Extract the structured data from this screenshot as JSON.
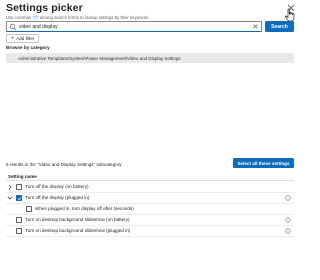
{
  "header": {
    "title": "Settings picker",
    "subtitle_before": "Use commas",
    "subtitle_highlight": "\",\"",
    "subtitle_after": "among search terms to lookup settings by their keywords"
  },
  "search": {
    "value": "video and display",
    "button_label": "Search"
  },
  "filters": {
    "add_filter_label": "Add filter"
  },
  "browse": {
    "label": "Browse by category",
    "category_path": "Administrative Templates\\System\\Power Management\\Video and Display Settings"
  },
  "results": {
    "count_text": "6 results in the \"Video and Display Settings\" subcategory",
    "select_all_label": "Select all these settings",
    "column_header": "Setting name",
    "rows": [
      {
        "label": "Turn off the display (on battery)",
        "checked": false,
        "expanded": false
      },
      {
        "label": "Turn off the display (plugged in)",
        "checked": true,
        "expanded": true
      },
      {
        "label": "When plugged in, turn display off after (seconds)",
        "checked": false,
        "child": true
      },
      {
        "label": "Turn on desktop background slideshow (on battery)",
        "checked": false
      },
      {
        "label": "Turn on desktop background slideshow (plugged in)",
        "checked": false
      }
    ]
  },
  "colors": {
    "accent": "#0f6cbd",
    "category_bg": "#e9e9e9"
  }
}
